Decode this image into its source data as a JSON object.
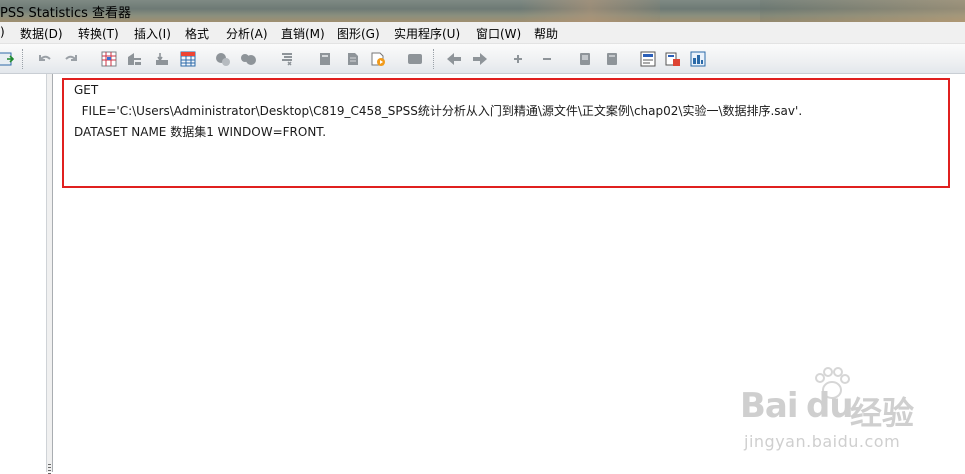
{
  "window": {
    "title": "PSS Statistics 查看器"
  },
  "menu": [
    {
      "id": "file-partial",
      "label": ")"
    },
    {
      "id": "data",
      "label": "数据(D)"
    },
    {
      "id": "transform",
      "label": "转换(T)"
    },
    {
      "id": "insert",
      "label": "插入(I)"
    },
    {
      "id": "format",
      "label": "格式"
    },
    {
      "id": "analyze",
      "label": "分析(A)"
    },
    {
      "id": "direct-marketing",
      "label": "直销(M)"
    },
    {
      "id": "graphs",
      "label": "图形(G)"
    },
    {
      "id": "utilities",
      "label": "实用程序(U)"
    },
    {
      "id": "window",
      "label": "窗口(W)"
    },
    {
      "id": "help",
      "label": "帮助"
    }
  ],
  "toolbar": {
    "icons": [
      "export-icon",
      "undo-icon",
      "redo-icon",
      "goto-data-icon",
      "goto-case-icon",
      "goto-variable-icon",
      "variables-icon",
      "use-variable-sets-icon",
      "show-all-variables-icon",
      "designate-window-icon",
      "new-output-icon",
      "new-syntax-icon",
      "create-script-icon",
      "insert-text-icon",
      "back-icon",
      "forward-icon",
      "expand-icon",
      "collapse-icon",
      "show-icon",
      "hide-icon",
      "insert-heading-icon",
      "insert-title-icon",
      "insert-chart-icon"
    ]
  },
  "syntax": {
    "lines": [
      "GET",
      "  FILE='C:\\Users\\Administrator\\Desktop\\C819_C458_SPSS统计分析从入门到精通\\源文件\\正文案例\\chap02\\实验一\\数据排序.sav'.",
      "DATASET NAME 数据集1 WINDOW=FRONT."
    ]
  },
  "watermark": {
    "brand": "Bai",
    "brand_du": "du",
    "brand_cn": "经验",
    "url": "jingyan.baidu.com"
  },
  "colors": {
    "highlight_border": "#e0201f",
    "watermark": "#cfcfcf"
  }
}
